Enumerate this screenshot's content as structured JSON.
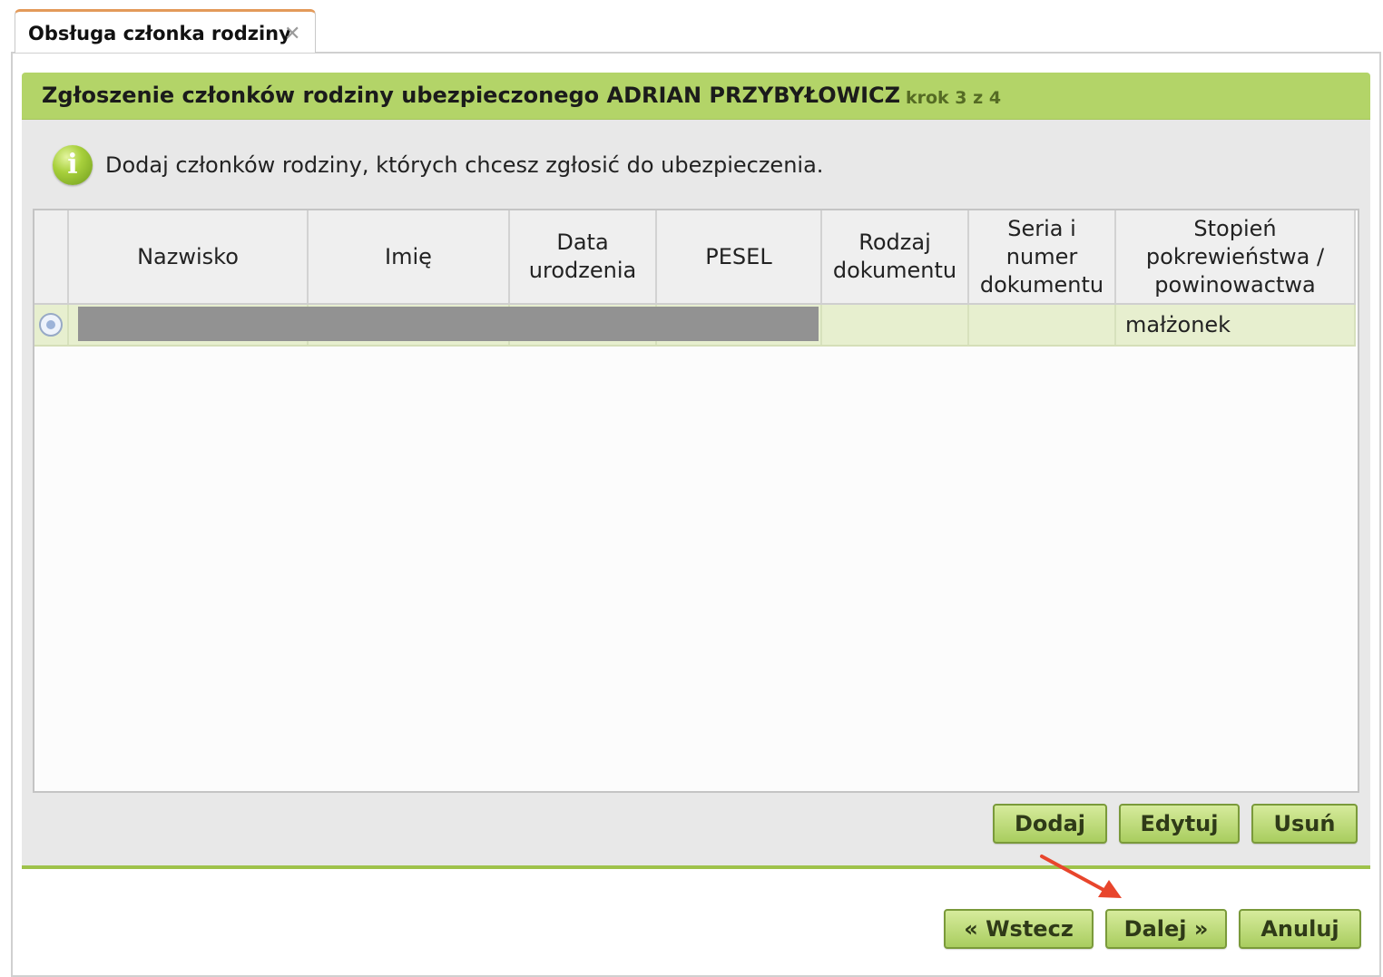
{
  "tab": {
    "label": "Obsługa członka rodziny",
    "close_icon": "close-icon"
  },
  "panel": {
    "title": "Zgłoszenie członków rodziny ubezpieczonego ADRIAN PRZYBYŁOWICZ",
    "step": "krok 3 z 4"
  },
  "info": {
    "icon": "info-icon",
    "text": "Dodaj członków rodziny, których chcesz zgłosić do ubezpieczenia."
  },
  "table": {
    "columns": [
      "Nazwisko",
      "Imię",
      "Data urodzenia",
      "PESEL",
      "Rodzaj dokumentu",
      "Seria i numer dokumentu",
      "Stopień pokrewieństwa / powinowactwa"
    ],
    "rows": [
      {
        "nazwisko": "",
        "imie": "",
        "data_urodzenia": "",
        "pesel": "",
        "rodzaj_dokumentu": "",
        "seria_numer": "",
        "stopien": "małżonek",
        "redacted": true
      }
    ]
  },
  "table_actions": {
    "add": "Dodaj",
    "edit": "Edytuj",
    "delete": "Usuń"
  },
  "footer": {
    "back": "« Wstecz",
    "next": "Dalej »",
    "cancel": "Anuluj"
  },
  "colors": {
    "header_green": "#b3d468",
    "button_green": "#a9cd5f",
    "tab_accent": "#e39a5a",
    "selected_row": "#e7efcf",
    "arrow": "#e8452c"
  }
}
